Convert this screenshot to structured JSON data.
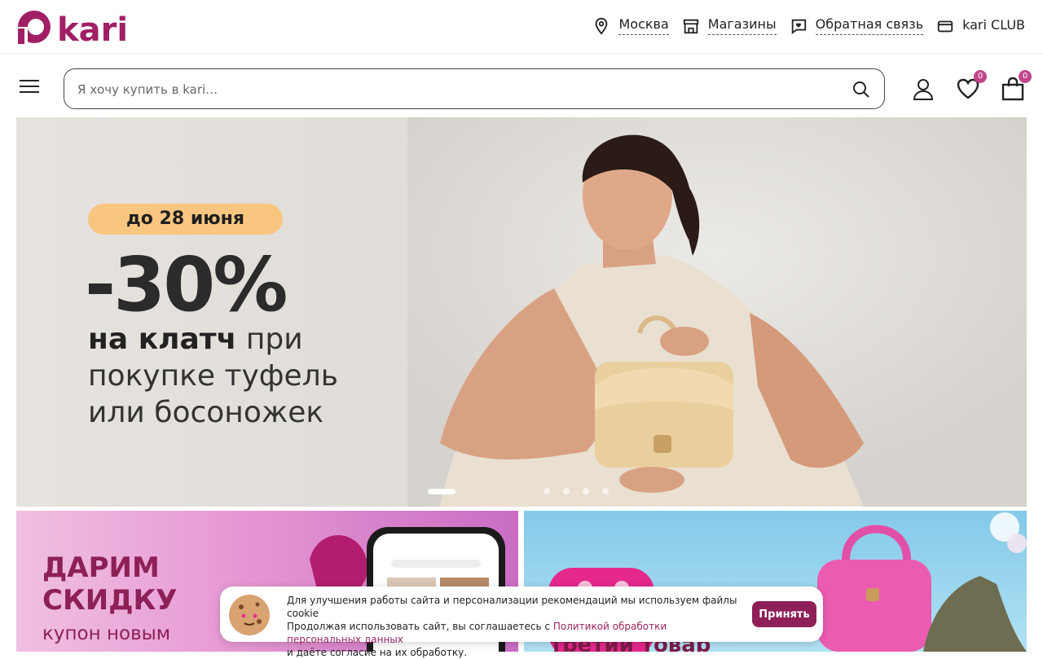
{
  "brand": {
    "logo_text": "kari",
    "color": "#a01f65"
  },
  "header": {
    "links": [
      {
        "label": "Москва",
        "icon": "location-pin-icon"
      },
      {
        "label": "Магазины",
        "icon": "store-icon"
      },
      {
        "label": "Обратная связь",
        "icon": "feedback-heart-icon"
      },
      {
        "label": "kari CLUB",
        "icon": "card-icon"
      }
    ]
  },
  "nav": {
    "menu_icon": "hamburger-menu-icon",
    "search": {
      "placeholder": "Я хочу купить в kari…",
      "value": "",
      "icon": "search-icon"
    },
    "profile_icon": "user-icon",
    "favorites": {
      "icon": "heart-icon",
      "count": "0"
    },
    "cart": {
      "icon": "shopping-bag-icon",
      "count": "0"
    }
  },
  "hero": {
    "deadline": "до 28 июня",
    "discount": "-30%",
    "offer_bold": "на клатч",
    "offer_line1_rest": " при",
    "offer_line2": "покупке туфель",
    "offer_line3": "или босоножек",
    "slides_total": 5,
    "active_slide": 1,
    "badge_color": "#f8c680"
  },
  "promos": [
    {
      "line1": "ДАРИМ",
      "line2": "СКИДКУ",
      "sub": "купон новым"
    },
    {
      "sub": "третий товар"
    }
  ],
  "cookie_banner": {
    "line1": "Для улучшения работы сайта и персонализации рекомендаций мы используем файлы cookie",
    "line2_prefix": "Продолжая использовать сайт, вы соглашаетесь с ",
    "link_text": "Политикой обработки персональных данных",
    "line3": "и даёте согласие на их обработку.",
    "accept_label": "Принять",
    "icon": "cookie-icon"
  }
}
